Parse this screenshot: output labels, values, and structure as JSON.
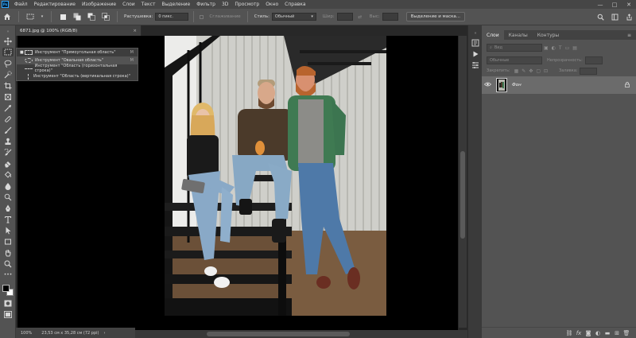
{
  "app": {
    "logo": "Ps",
    "menu": [
      "Файл",
      "Редактирование",
      "Изображение",
      "Слои",
      "Текст",
      "Выделение",
      "Фильтр",
      "3D",
      "Просмотр",
      "Окно",
      "Справка"
    ],
    "window_controls": [
      "—",
      "□",
      "✕"
    ]
  },
  "options": {
    "feather_label": "Растушевка:",
    "feather_value": "0 пикс.",
    "antialias_label": "Сглаживание",
    "style_label": "Стиль:",
    "style_value": "Обычный",
    "width_label": "Шир:",
    "height_label": "Выс:",
    "select_mask_button": "Выделение и маска..."
  },
  "document": {
    "tab_title": "6871.jpg @ 100% (RGB/8)",
    "tab_close": "×"
  },
  "flyout": {
    "items": [
      {
        "label": "Инструмент \"Прямоугольная область\"",
        "key": "M"
      },
      {
        "label": "Инструмент \"Овальная область\"",
        "key": "M"
      },
      {
        "label": "Инструмент \"Область (горизонтальная строка)\"",
        "key": ""
      },
      {
        "label": "Инструмент \"Область (вертикальная строка)\"",
        "key": ""
      }
    ]
  },
  "status": {
    "zoom": "100%",
    "doc_size": "23,53 см x 35,28 см (72 ppi)"
  },
  "layers_panel": {
    "tabs": [
      "Слои",
      "Каналы",
      "Контуры"
    ],
    "search_placeholder": "Вид",
    "blend_mode": "Обычные",
    "opacity_label": "Непрозрачность:",
    "lock_label": "Закрепить:",
    "fill_label": "Заливка:",
    "layer_name": "Фон"
  }
}
